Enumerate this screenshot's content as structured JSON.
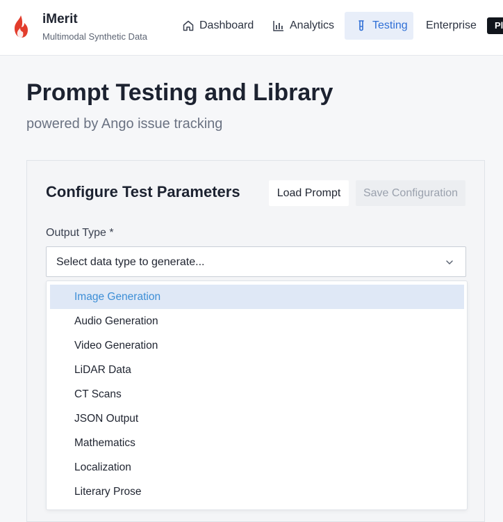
{
  "brand": {
    "name": "iMerit",
    "subtitle": "Multimodal Synthetic Data",
    "accent_color": "#e23c2c",
    "logo_icon": "flame-icon"
  },
  "nav": {
    "items": [
      {
        "label": "Dashboard",
        "icon": "home-icon",
        "active": false
      },
      {
        "label": "Analytics",
        "icon": "bar-chart-icon",
        "active": true
      },
      {
        "label": "Testing",
        "icon": "test-tube-icon",
        "active": true
      },
      {
        "label": "Enterprise",
        "icon": "",
        "active": false
      }
    ],
    "cutoff_button_label": "Pl",
    "active_color": "#2f6fd6"
  },
  "page": {
    "title": "Prompt Testing and Library",
    "subtitle": "powered by Ango issue tracking"
  },
  "panel": {
    "title": "Configure Test Parameters",
    "load_button": "Load Prompt",
    "save_button": "Save Configuration",
    "output_type_label": "Output Type *",
    "select_placeholder": "Select data type to generate...",
    "options": [
      "Image Generation",
      "Audio Generation",
      "Video Generation",
      "LiDAR Data",
      "CT Scans",
      "JSON Output",
      "Mathematics",
      "Localization",
      "Literary Prose"
    ],
    "highlighted_option": "Image Generation"
  }
}
